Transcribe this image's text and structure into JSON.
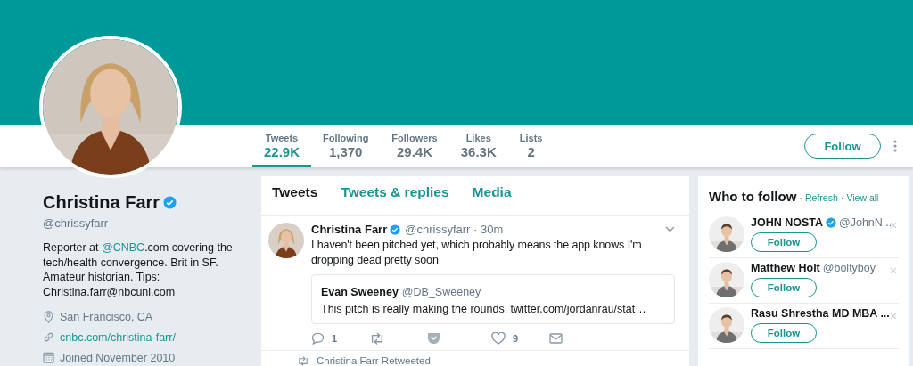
{
  "profile": {
    "name": "Christina Farr",
    "verified": true,
    "handle": "@chrissyfarr",
    "bio": [
      {
        "kind": "text",
        "text": "Reporter at "
      },
      {
        "kind": "link",
        "text": "@CNBC"
      },
      {
        "kind": "text",
        "text": ".com covering the tech/health convergence. Brit in SF. Amateur historian. Tips: Christina.farr@nbcuni.com"
      }
    ],
    "details": [
      {
        "kind": "location",
        "text": "San Francisco, CA"
      },
      {
        "kind": "link",
        "text": "cnbc.com/christina-farr/"
      },
      {
        "kind": "joined",
        "text": "Joined November 2010"
      }
    ]
  },
  "stats": [
    {
      "label": "Tweets",
      "value": "22.9K",
      "selected": true
    },
    {
      "label": "Following",
      "value": "1,370",
      "selected": false
    },
    {
      "label": "Followers",
      "value": "29.4K",
      "selected": false
    },
    {
      "label": "Likes",
      "value": "36.3K",
      "selected": false
    },
    {
      "label": "Lists",
      "value": "2",
      "selected": false
    }
  ],
  "follow_button": "Follow",
  "timeline_tabs": [
    {
      "label": "Tweets",
      "selected": true
    },
    {
      "label": "Tweets & replies",
      "selected": false
    },
    {
      "label": "Media",
      "selected": false
    }
  ],
  "tweet": {
    "name": "Christina Farr",
    "verified": true,
    "meta": "@chrissyfarr · 30m",
    "text": "I haven't been pitched yet, which probably means the app knows I'm dropping dead pretty soon",
    "quote": {
      "name": "Evan Sweeney",
      "handle": "@DB_Sweeney",
      "text": "This pitch is really making the rounds. twitter.com/jordanrau/stat…"
    },
    "actions": [
      {
        "kind": "reply",
        "count": "1"
      },
      {
        "kind": "retweet"
      },
      {
        "kind": "pocket"
      },
      {
        "kind": "like",
        "count": "9"
      },
      {
        "kind": "message"
      }
    ]
  },
  "retweet_notice": "Christina Farr Retweeted",
  "who_to_follow": {
    "title": "Who to follow",
    "links": [
      {
        "prefix": "·",
        "label": "Refresh"
      },
      {
        "prefix": "·",
        "label": "View all"
      }
    ],
    "items": [
      {
        "name": "JOHN NOSTA",
        "verified": true,
        "handle": "@JohnN...",
        "button": "Follow"
      },
      {
        "name": "Matthew Holt",
        "verified": false,
        "handle": "@boltyboy",
        "button": "Follow"
      },
      {
        "name": "Rasu Shrestha MD MBA ...",
        "verified": false,
        "button": "Follow"
      }
    ]
  }
}
